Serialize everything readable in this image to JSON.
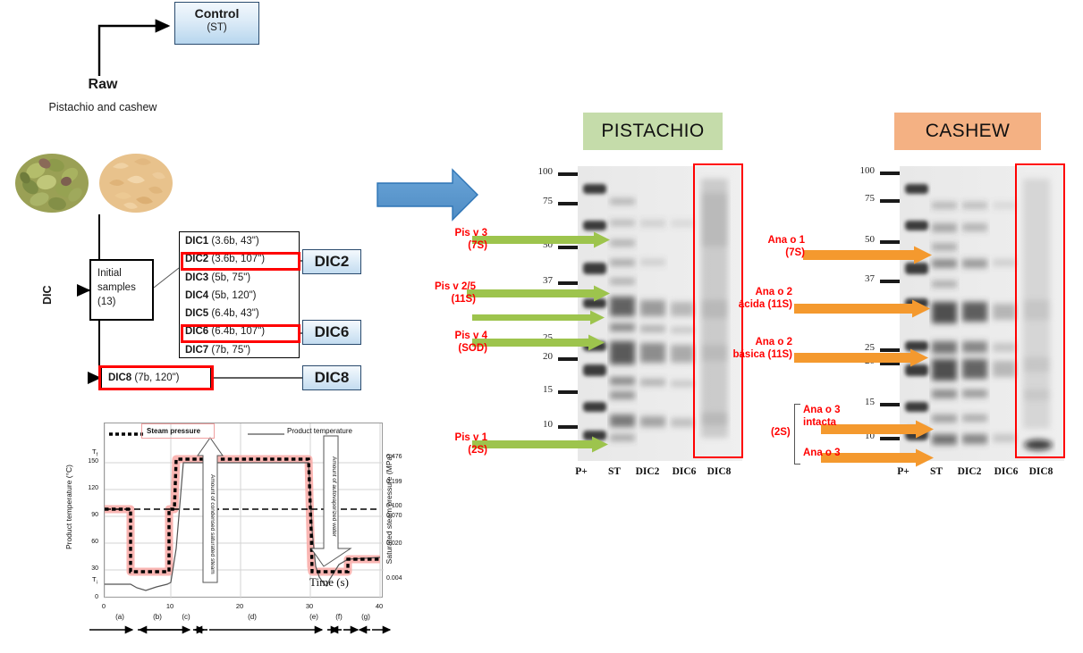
{
  "flow": {
    "control": {
      "title": "Control",
      "sub": "(ST)"
    },
    "raw": {
      "title": "Raw",
      "sub": "Pistachio and cashew"
    },
    "dic_label": "DIC",
    "initial_samples": {
      "line1": "Initial",
      "line2": "samples",
      "line3": "(13)"
    },
    "treatments": [
      {
        "code": "DIC1",
        "params": "(3.6b, 43\")",
        "highlight": false
      },
      {
        "code": "DIC2",
        "params": "(3.6b, 107\")",
        "highlight": true
      },
      {
        "code": "DIC3",
        "params": "(5b, 75\")",
        "highlight": false
      },
      {
        "code": "DIC4",
        "params": "(5b, 120\")",
        "highlight": false
      },
      {
        "code": "DIC5",
        "params": "(6.4b, 43\")",
        "highlight": false
      },
      {
        "code": "DIC6",
        "params": "(6.4b, 107\")",
        "highlight": true
      },
      {
        "code": "DIC7",
        "params": "(7b, 75\")",
        "highlight": false
      }
    ],
    "treatment8": {
      "code": "DIC8",
      "params": "(7b, 120\")",
      "highlight": true
    },
    "chips": [
      "DIC2",
      "DIC6",
      "DIC8"
    ],
    "arrow_icon": "right-arrow-icon",
    "colors": {
      "chip": "#c3dcf0",
      "highlight": "#ff0000",
      "arrow": "#5b9bd5"
    }
  },
  "chart_data": {
    "type": "line",
    "title": "",
    "xlabel": "Time  (s)",
    "ylabel": "Product temperature (°C)",
    "y2label": "Saturated steam pressure (MPa)",
    "xlim": [
      0,
      40
    ],
    "ylim": [
      0,
      165
    ],
    "xticks": [
      "0",
      "10",
      "20",
      "30",
      "40"
    ],
    "yticks": [
      "0",
      "30",
      "60",
      "90",
      "120",
      "150"
    ],
    "y2ticks": [
      "0.004",
      "0.020",
      "0.070",
      "0.100",
      "0.199",
      "0.476"
    ],
    "grid": true,
    "legend": [
      {
        "name": "Steam pressure",
        "style": "dotted",
        "color": "#000000"
      },
      {
        "name": "Product temperature",
        "style": "solid",
        "color": "#555555"
      }
    ],
    "marker_labels": {
      "t_final": "T",
      "t_final_sub": "f",
      "t_initial": "T",
      "t_initial_sub": "i"
    },
    "annotations": [
      "Amount of condensed saturated steam",
      "Amount of autovaporized water"
    ],
    "phases": [
      "(a)",
      "(b)",
      "(c)",
      "(d)",
      "(e)",
      "(f)",
      "(g)"
    ],
    "series": [
      {
        "name": "Steam pressure",
        "x": [
          0,
          4,
          4.6,
          9,
          9.6,
          11,
          29.5,
          30.5,
          31.5,
          35.5,
          40
        ],
        "values": [
          100,
          100,
          35,
          35,
          100,
          152,
          152,
          60,
          36,
          44,
          45
        ]
      },
      {
        "name": "Product temperature",
        "x": [
          0,
          4,
          5.5,
          6.5,
          9.3,
          10.5,
          12,
          29.5,
          31,
          32,
          33,
          35.5,
          40
        ],
        "values": [
          20,
          20,
          18,
          16,
          20,
          60,
          150,
          150,
          60,
          34,
          24,
          44,
          47
        ]
      }
    ],
    "reference_line": {
      "label": "0.100",
      "y_value": 100
    }
  },
  "gels": {
    "pistachio": {
      "title": "PISTACHIO",
      "title_bg": "#c5dcaa",
      "arrow_color": "#9dc44d",
      "mw_markers": [
        "100",
        "75",
        "50",
        "37",
        "25",
        "20",
        "15",
        "10"
      ],
      "lanes": [
        "P+",
        "ST",
        "DIC2",
        "DIC6",
        "DIC8"
      ],
      "highlight_lane": "DIC8",
      "annotations": [
        {
          "line1": "Pis v 3",
          "line2": "(7S)"
        },
        {
          "line1": "Pis v 2/5",
          "line2": "(11S)"
        },
        {
          "line1": "Pis v 4",
          "line2": "(SOD)"
        },
        {
          "line1": "Pis v 1",
          "line2": "(2S)"
        }
      ]
    },
    "cashew": {
      "title": "CASHEW",
      "title_bg": "#f4b183",
      "arrow_color": "#f4992e",
      "mw_markers": [
        "100",
        "75",
        "50",
        "37",
        "25",
        "20",
        "15",
        "10"
      ],
      "lanes": [
        "P+",
        "ST",
        "DIC2",
        "DIC6",
        "DIC8"
      ],
      "highlight_lane": "DIC8",
      "bracket_label": "(2S)",
      "annotations": [
        {
          "line1": "Ana o 1",
          "line2": "(7S)"
        },
        {
          "line1": "Ana o 2",
          "line2": "ácida (11S)"
        },
        {
          "line1": "Ana o 2",
          "line2": "básica (11S)"
        },
        {
          "line1": "Ana o 3",
          "line2": "intacta"
        },
        {
          "line1": "Ana o 3",
          "line2": ""
        }
      ]
    }
  }
}
